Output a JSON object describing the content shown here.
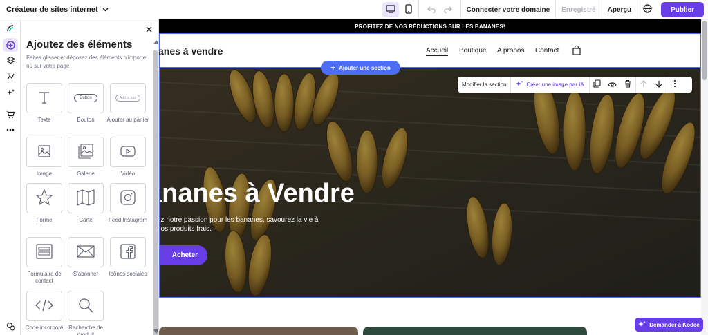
{
  "topbar": {
    "builder_name": "Créateur de sites internet",
    "connect_domain": "Connecter votre domaine",
    "saved": "Enregistré",
    "preview": "Aperçu",
    "publish": "Publier"
  },
  "panel": {
    "title": "Ajoutez des éléments",
    "description": "Faites glisser et déposez des éléments n'importe où sur votre page",
    "items": [
      {
        "label": "Texte",
        "icon": "text-icon"
      },
      {
        "label": "Bouton",
        "icon": "button-icon",
        "preview_text": "Button"
      },
      {
        "label": "Ajouter au panier",
        "icon": "add-to-bag-icon",
        "preview_text": "Add to bag"
      },
      {
        "label": "Image",
        "icon": "image-icon"
      },
      {
        "label": "Galerie",
        "icon": "gallery-icon"
      },
      {
        "label": "Vidéo",
        "icon": "video-icon"
      },
      {
        "label": "Forme",
        "icon": "star-icon"
      },
      {
        "label": "Carte",
        "icon": "map-icon"
      },
      {
        "label": "Feed Instagram",
        "icon": "instagram-icon"
      },
      {
        "label": "Formulaire de contact",
        "icon": "form-icon"
      },
      {
        "label": "S'abonner",
        "icon": "envelope-icon"
      },
      {
        "label": "Icônes sociales",
        "icon": "facebook-icon"
      },
      {
        "label": "Code incorporé",
        "icon": "code-icon"
      },
      {
        "label": "Recherche de produit",
        "icon": "search-icon"
      }
    ]
  },
  "site": {
    "promo": "PROFITEZ DE NOS RÉDUCTIONS SUR LES BANANES!",
    "name": "anes à vendre",
    "nav": [
      "Accueil",
      "Boutique",
      "A propos",
      "Contact"
    ],
    "hero_title": "ananes à Vendre",
    "hero_subtitle_line1": "ez notre passion pour les bananes, savourez la vie à",
    "hero_subtitle_line2": "nos produits frais.",
    "hero_button": "Acheter"
  },
  "section_toolbar": {
    "add_section": "Ajouter une section",
    "edit_section": "Modifier la section",
    "create_ai_image": "Créer une image par IA"
  },
  "assistant": {
    "ask_kodee": "Demander à Kodee"
  },
  "colors": {
    "accent": "#673de6",
    "selection_blue": "#4d6df5",
    "accent_soft": "#ebe4ff"
  }
}
